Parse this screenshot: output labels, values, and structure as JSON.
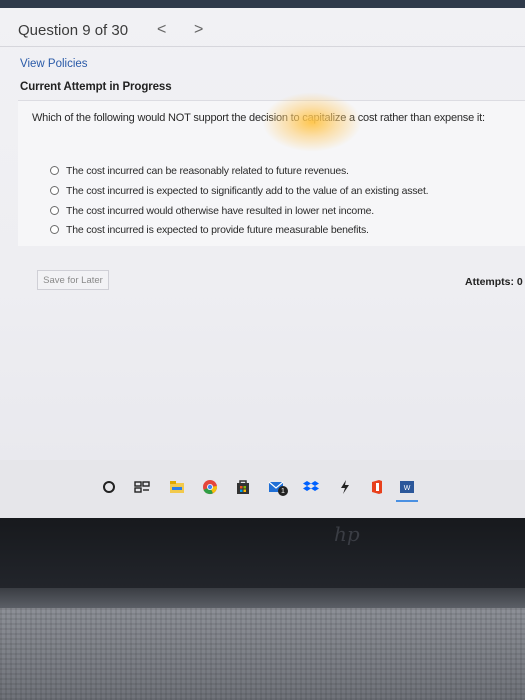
{
  "header": {
    "question_label": "Question 9 of 30",
    "prev_glyph": "<",
    "next_glyph": ">"
  },
  "links": {
    "view_policies": "View Policies"
  },
  "status": {
    "text": "Current Attempt in Progress"
  },
  "question": {
    "text": "Which of the following would NOT support the decision to capitalize a cost rather than expense it:",
    "options": [
      "The cost incurred can be reasonably related to future revenues.",
      "The cost incurred is expected to significantly add to the value of an existing asset.",
      "The cost incurred would otherwise have resulted in lower net income.",
      "The cost incurred is expected to provide future measurable benefits."
    ]
  },
  "actions": {
    "save_for_later": "Save for Later"
  },
  "attempts": {
    "text": "Attempts: 0"
  },
  "taskbar": {
    "icons": [
      "search-circle-icon",
      "task-view-icon",
      "file-explorer-icon",
      "chrome-icon",
      "store-icon",
      "mail-icon",
      "dropbox-icon",
      "bolt-icon",
      "office-icon",
      "word-icon"
    ],
    "mail_badge": "1",
    "word_label": "W"
  },
  "colors": {
    "link": "#2a5aa8",
    "glare": "#ffc446",
    "bezel": "#1b1d22"
  }
}
